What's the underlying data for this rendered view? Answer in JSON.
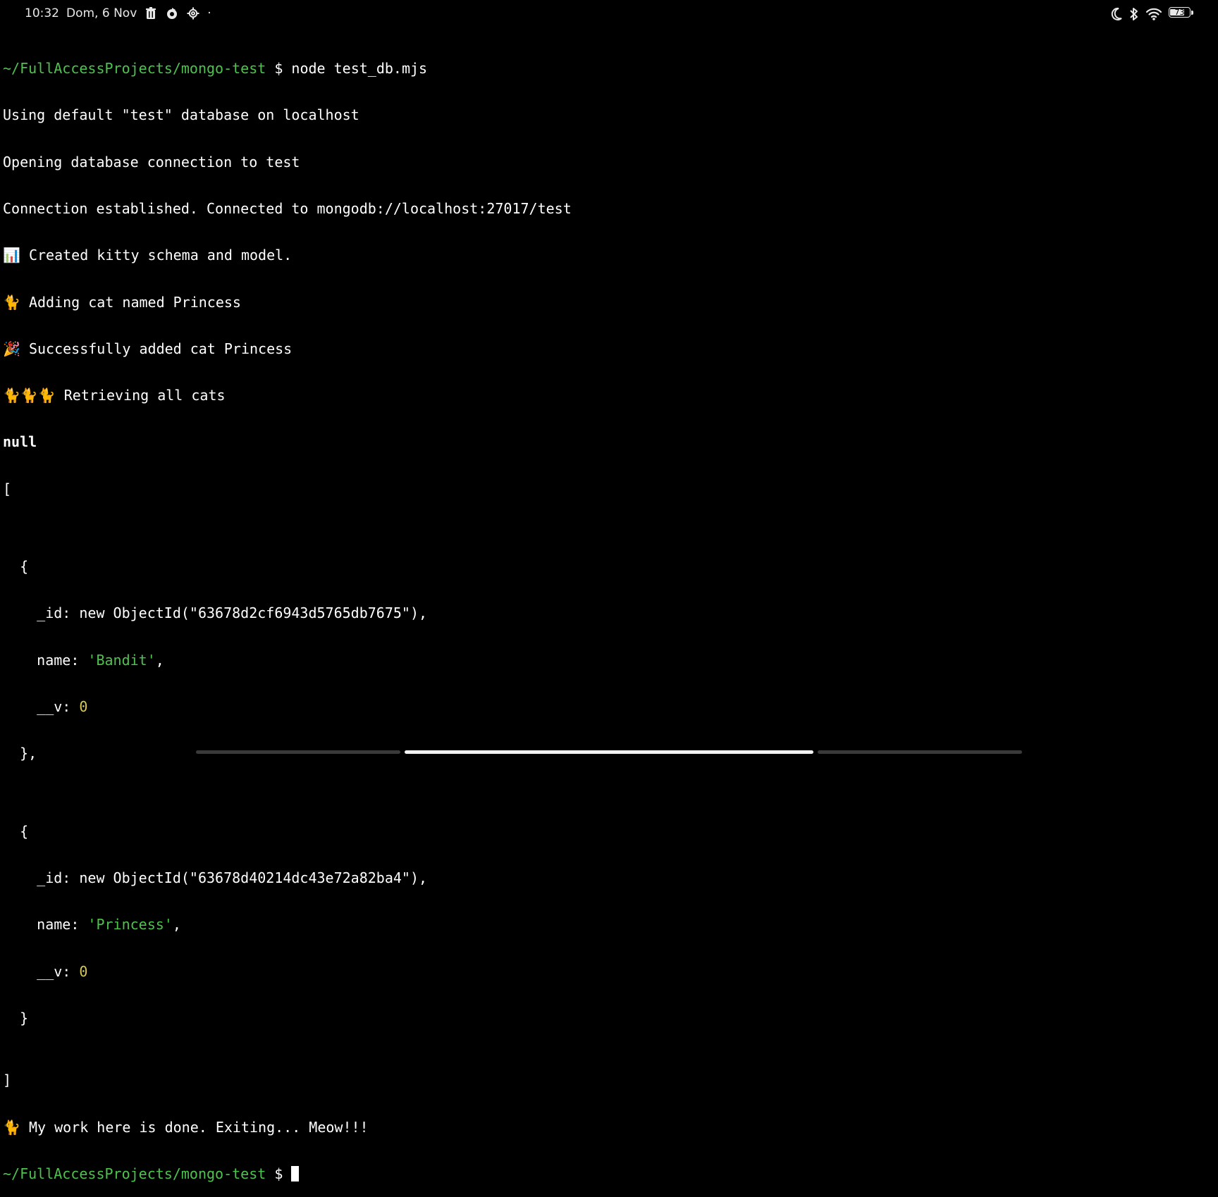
{
  "status_bar": {
    "time": "10:32",
    "date": "Dom, 6 Nov",
    "dot": "·",
    "icons_left": [
      "trash-icon",
      "sync-icon",
      "settings-icon"
    ],
    "icons_right": [
      "moon-icon",
      "bluetooth-icon",
      "wifi-icon",
      "battery-icon"
    ],
    "battery_level": "73",
    "battery_fraction": 0.73
  },
  "terminal": {
    "prompt_path": "~/FullAccessProjects/mongo-test",
    "prompt_symbol": "$",
    "command": "node test_db.mjs",
    "output": {
      "line1": "Using default \"test\" database on localhost",
      "line2": "Opening database connection to test",
      "line3": "Connection established. Connected to mongodb://localhost:27017/test",
      "line4_emoji": "📊",
      "line4_text": " Created kitty schema and model.",
      "line5_emoji": "🐈",
      "line5_text": " Adding cat named Princess",
      "line6_emoji": "🎉",
      "line6_text": " Successfully added cat Princess",
      "line7_emoji": "🐈🐈🐈",
      "line7_text": " Retrieving all cats",
      "null_text": "null",
      "open_bracket": "[",
      "close_bracket": "]",
      "exit_emoji": "🐈",
      "exit_text": " My work here is done. Exiting... Meow!!!"
    },
    "records": [
      {
        "open": "  {",
        "id_label": "    _id: new ObjectId(\"63678d2cf6943d5765db7675\"),",
        "name_key": "    name: ",
        "name_value": "'Bandit'",
        "name_suffix": ",",
        "v_key": "    __v: ",
        "v_value": "0",
        "close": "  },"
      },
      {
        "open": "  {",
        "id_label": "    _id: new ObjectId(\"63678d40214dc43e72a82ba4\"),",
        "name_key": "    name: ",
        "name_value": "'Princess'",
        "name_suffix": ",",
        "v_key": "    __v: ",
        "v_value": "0",
        "close": "  }"
      }
    ]
  },
  "colors": {
    "prompt_green": "#4ec24e",
    "number_yellow": "#d7c94e",
    "background": "#000000",
    "text": "#ffffff"
  }
}
